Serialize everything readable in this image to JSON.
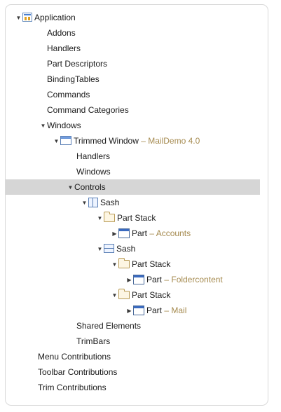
{
  "tree": {
    "application": {
      "label": "Application"
    },
    "addons": "Addons",
    "handlers": "Handlers",
    "part_descriptors": "Part Descriptors",
    "binding_tables": "BindingTables",
    "commands": "Commands",
    "command_categories": "Command Categories",
    "windows": "Windows",
    "trimmed_window": {
      "label": "Trimmed Window",
      "detail": "– MailDemo 4.0"
    },
    "tw_handlers": "Handlers",
    "tw_windows": "Windows",
    "controls": "Controls",
    "sash": "Sash",
    "part_stack_1": "Part Stack",
    "part_accounts": {
      "label": "Part",
      "detail": "– Accounts"
    },
    "sash_2": "Sash",
    "part_stack_2": "Part Stack",
    "part_foldercontent": {
      "label": "Part",
      "detail": "– Foldercontent"
    },
    "part_stack_3": "Part Stack",
    "part_mail": {
      "label": "Part",
      "detail": "– Mail"
    },
    "shared_elements": "Shared Elements",
    "trimbars": "TrimBars",
    "menu_contributions": "Menu Contributions",
    "toolbar_contributions": "Toolbar Contributions",
    "trim_contributions": "Trim Contributions"
  },
  "glyphs": {
    "expanded": "▼",
    "collapsed": "▶"
  },
  "colors": {
    "selection": "#d6d6d6",
    "detail_text": "#a58a4f"
  }
}
